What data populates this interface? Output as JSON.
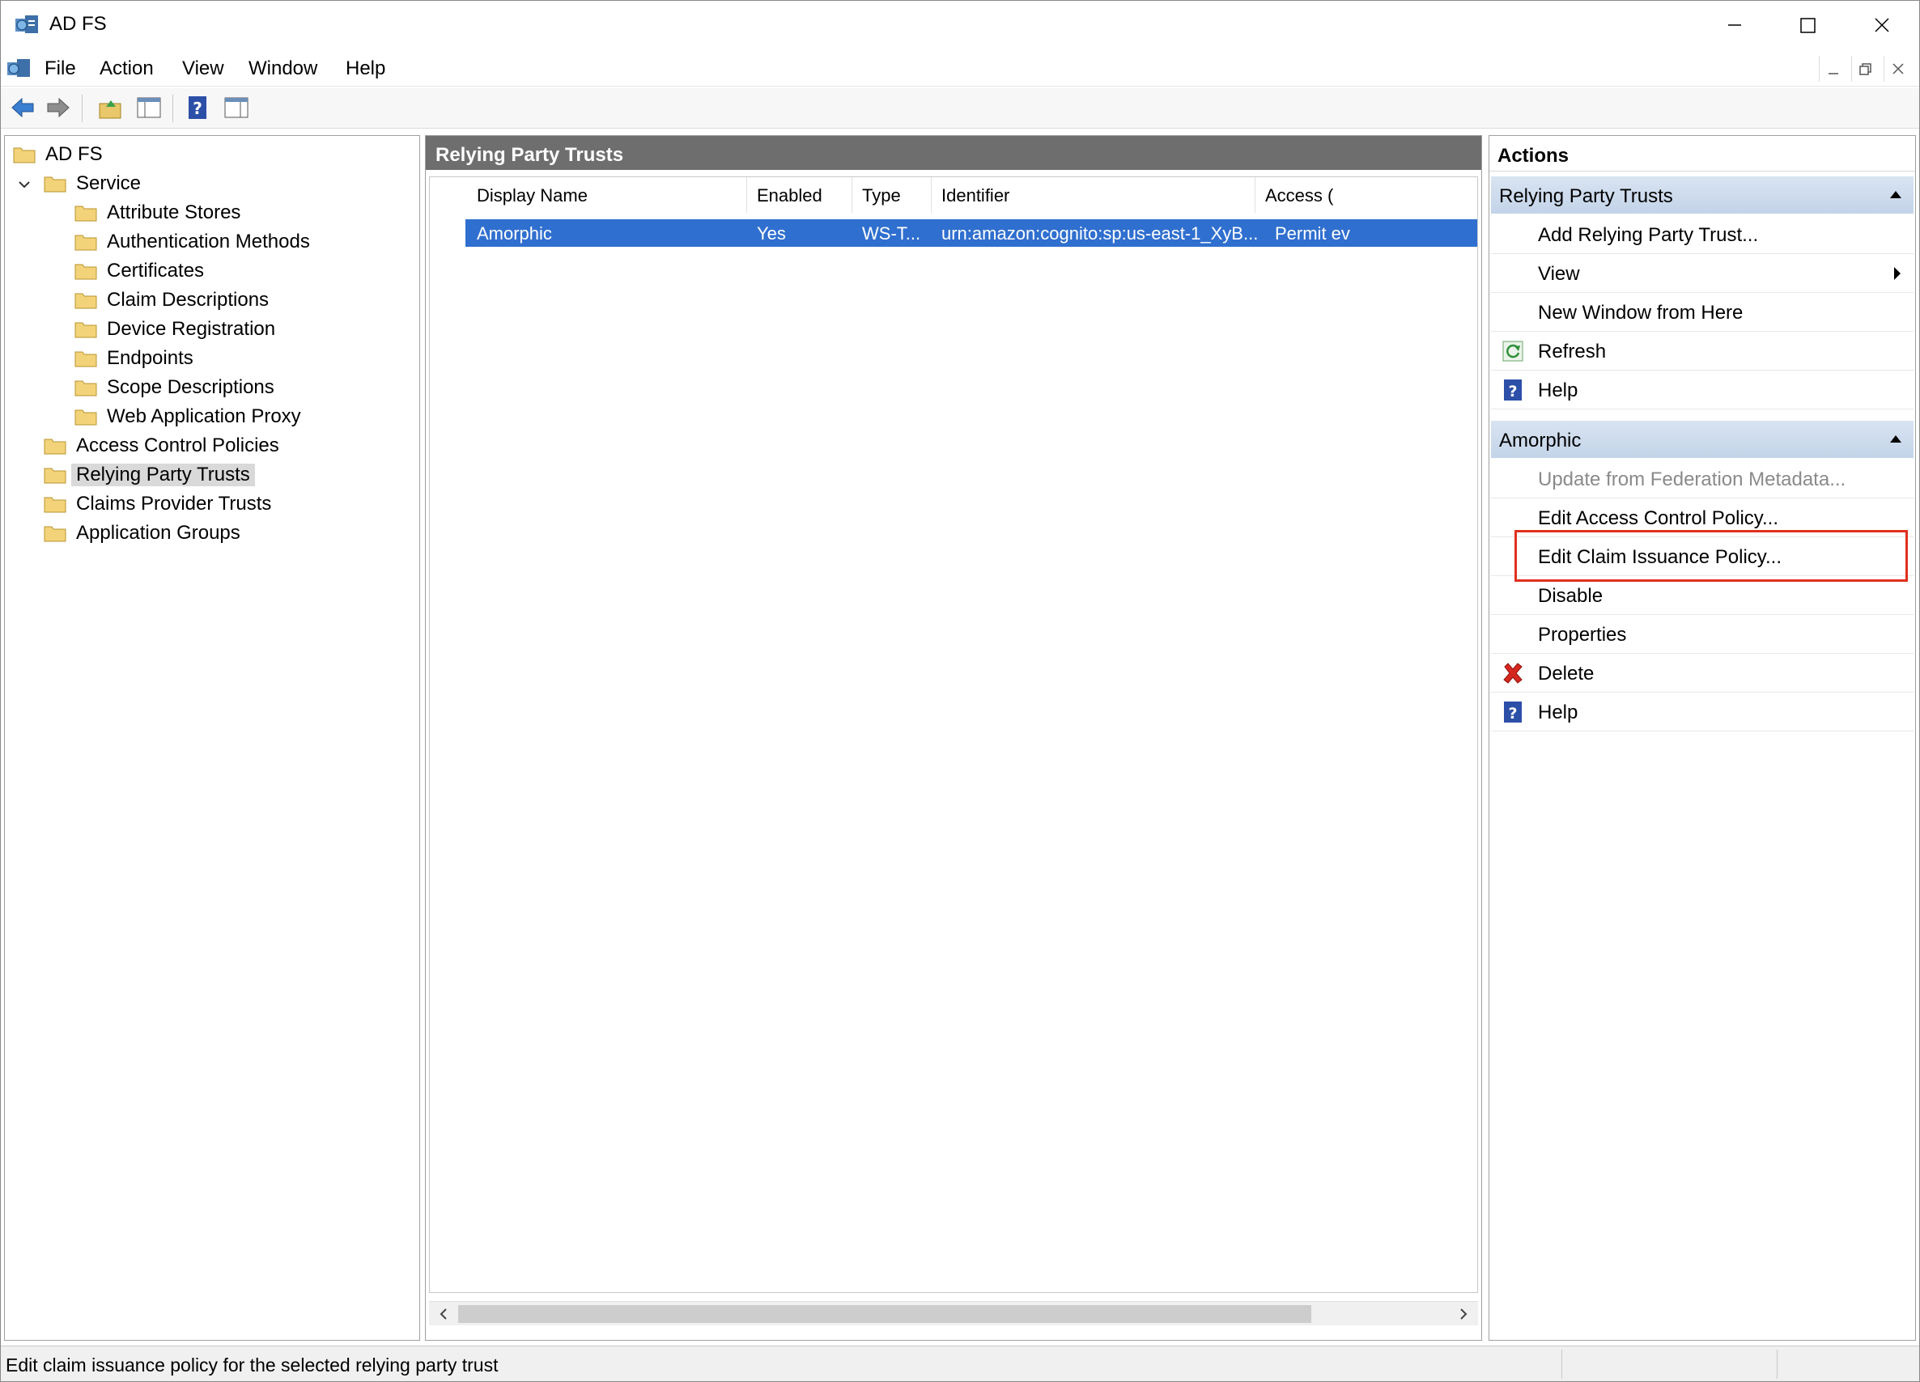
{
  "window": {
    "title": "AD FS"
  },
  "menu": {
    "items": [
      "File",
      "Action",
      "View",
      "Window",
      "Help"
    ]
  },
  "toolbar": {
    "buttons": [
      "back-icon",
      "forward-icon",
      "up-folder-icon",
      "show-hide-tree-icon",
      "help-icon",
      "show-hide-action-pane-icon"
    ]
  },
  "tree": {
    "root": "AD FS",
    "service": "Service",
    "service_children": [
      "Attribute Stores",
      "Authentication Methods",
      "Certificates",
      "Claim Descriptions",
      "Device Registration",
      "Endpoints",
      "Scope Descriptions",
      "Web Application Proxy"
    ],
    "top_level": [
      "Access Control Policies",
      "Relying Party Trusts",
      "Claims Provider Trusts",
      "Application Groups"
    ],
    "selected": "Relying Party Trusts"
  },
  "center": {
    "title": "Relying Party Trusts",
    "columns": [
      "Display Name",
      "Enabled",
      "Type",
      "Identifier",
      "Access ("
    ],
    "rows": [
      {
        "display_name": "Amorphic",
        "enabled": "Yes",
        "type": "WS-T...",
        "identifier": "urn:amazon:cognito:sp:us-east-1_XyB...",
        "access": "Permit ev"
      }
    ]
  },
  "actions": {
    "title": "Actions",
    "section1": {
      "header": "Relying Party Trusts",
      "items": [
        "Add Relying Party Trust...",
        "View",
        "New Window from Here",
        "Refresh",
        "Help"
      ]
    },
    "section2": {
      "header": "Amorphic",
      "items": [
        "Update from Federation Metadata...",
        "Edit Access Control Policy...",
        "Edit Claim Issuance Policy...",
        "Disable",
        "Properties",
        "Delete",
        "Help"
      ]
    },
    "highlight_color": "#e0301e"
  },
  "status": {
    "text": "Edit claim issuance policy for the selected relying party trust"
  },
  "colors": {
    "selection": "#2f6fcf",
    "header_bar": "#6e6e6e",
    "section_header": "#c3d3e8"
  }
}
